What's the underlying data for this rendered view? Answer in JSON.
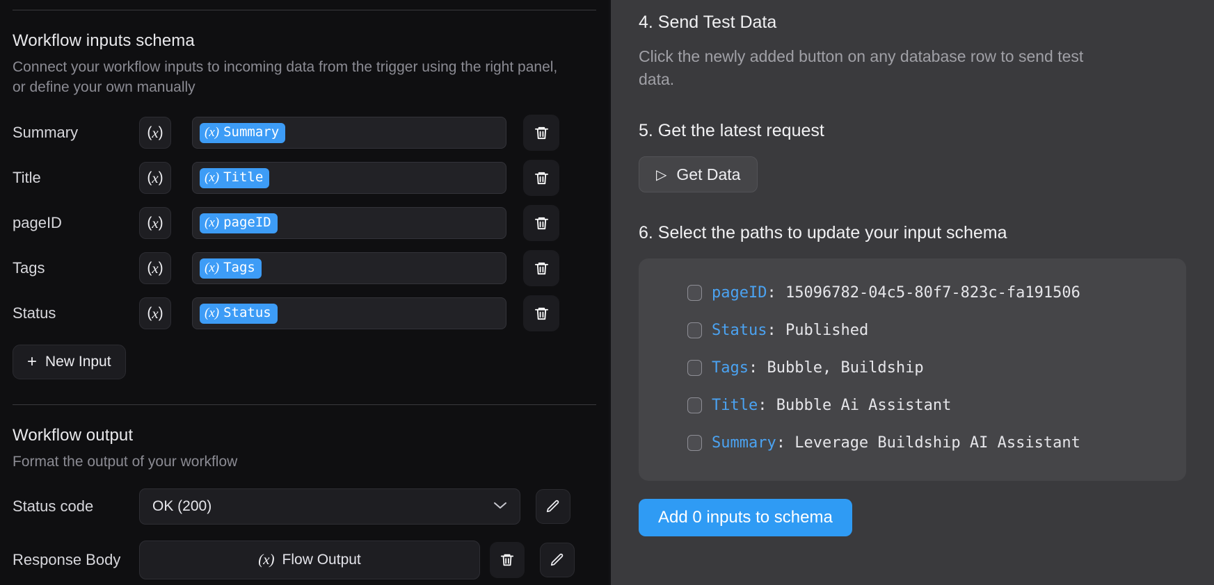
{
  "left_panel": {
    "inputs_section": {
      "title": "Workflow inputs schema",
      "description": "Connect your workflow inputs to incoming data from the trigger using the right panel, or define your own manually",
      "variable_glyph": "(x)",
      "rows": [
        {
          "label": "Summary",
          "chip_prefix": "(x)",
          "chip_label": "Summary"
        },
        {
          "label": "Title",
          "chip_prefix": "(x)",
          "chip_label": "Title"
        },
        {
          "label": "pageID",
          "chip_prefix": "(x)",
          "chip_label": "pageID"
        },
        {
          "label": "Tags",
          "chip_prefix": "(x)",
          "chip_label": "Tags"
        },
        {
          "label": "Status",
          "chip_prefix": "(x)",
          "chip_label": "Status"
        }
      ],
      "new_input_label": "New Input",
      "new_input_plus": "+"
    },
    "output_section": {
      "title": "Workflow output",
      "description": "Format the output of your workflow",
      "status_code_label": "Status code",
      "status_code_value": "OK (200)",
      "status_code_chevron": "⌄",
      "response_body_label": "Response Body",
      "response_body_prefix": "(x)",
      "response_body_value": "Flow Output"
    }
  },
  "right_panel": {
    "step4_title": "4. Send Test Data",
    "step4_desc": "Click the newly added button on any database row to send test data.",
    "step5_title": "5. Get the latest request",
    "get_data_label": "Get Data",
    "get_data_play": "▷",
    "step6_title": "6. Select the paths to update your input schema",
    "paths": [
      {
        "key": "pageID",
        "value": "15096782-04c5-80f7-823c-fa191506"
      },
      {
        "key": "Status",
        "value": "Published"
      },
      {
        "key": "Tags",
        "value": "Bubble, Buildship"
      },
      {
        "key": "Title",
        "value": "Bubble Ai Assistant"
      },
      {
        "key": "Summary",
        "value": "Leverage Buildship AI Assistant"
      }
    ],
    "path_separator": ": ",
    "add_button_label": "Add 0 inputs to schema"
  },
  "colors": {
    "accent_blue": "#2f9bf4",
    "chip_blue": "#3d9cf6",
    "path_key_blue": "#4ba3f2",
    "left_bg": "#0f0f11",
    "right_bg": "#3a3a3d",
    "card_bg": "#454548"
  }
}
